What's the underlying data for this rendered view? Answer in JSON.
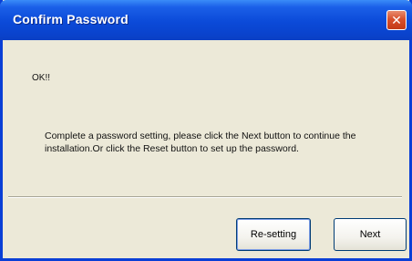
{
  "window": {
    "title": "Confirm Password",
    "close_glyph": "✕"
  },
  "content": {
    "ok_text": "OK!!",
    "message": "Complete a password setting, please click the Next button to continue the installation.Or click the Reset button to set up the password."
  },
  "buttons": {
    "resetting_label": "Re-setting",
    "next_label": "Next"
  },
  "colors": {
    "titlebar": "#0b4ad8",
    "frame": "#0a3fd6",
    "client_bg": "#ece9d8",
    "close_button": "#d8502c"
  },
  "icons": {
    "close": "close-icon"
  }
}
